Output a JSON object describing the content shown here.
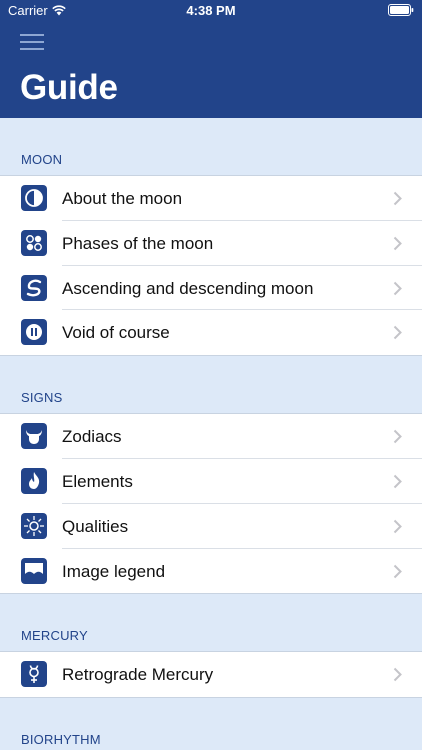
{
  "status": {
    "carrier": "Carrier",
    "time": "4:38 PM"
  },
  "header": {
    "title": "Guide"
  },
  "sections": [
    {
      "label": "MOON",
      "items": [
        {
          "label": "About the moon",
          "icon": "moon-half-icon"
        },
        {
          "label": "Phases of the moon",
          "icon": "moon-phases-icon"
        },
        {
          "label": "Ascending and descending moon",
          "icon": "ascending-moon-icon"
        },
        {
          "label": "Void of course",
          "icon": "void-of-course-icon"
        }
      ]
    },
    {
      "label": "SIGNS",
      "items": [
        {
          "label": "Zodiacs",
          "icon": "bull-icon"
        },
        {
          "label": "Elements",
          "icon": "flame-icon"
        },
        {
          "label": "Qualities",
          "icon": "sun-icon"
        },
        {
          "label": "Image legend",
          "icon": "image-icon"
        }
      ]
    },
    {
      "label": "MERCURY",
      "items": [
        {
          "label": "Retrograde Mercury",
          "icon": "mercury-icon"
        }
      ]
    },
    {
      "label": "BIORHYTHM",
      "items": []
    }
  ],
  "colors": {
    "header": "#22448a",
    "section_bg": "#dde9f8",
    "section_text": "#22448a"
  }
}
